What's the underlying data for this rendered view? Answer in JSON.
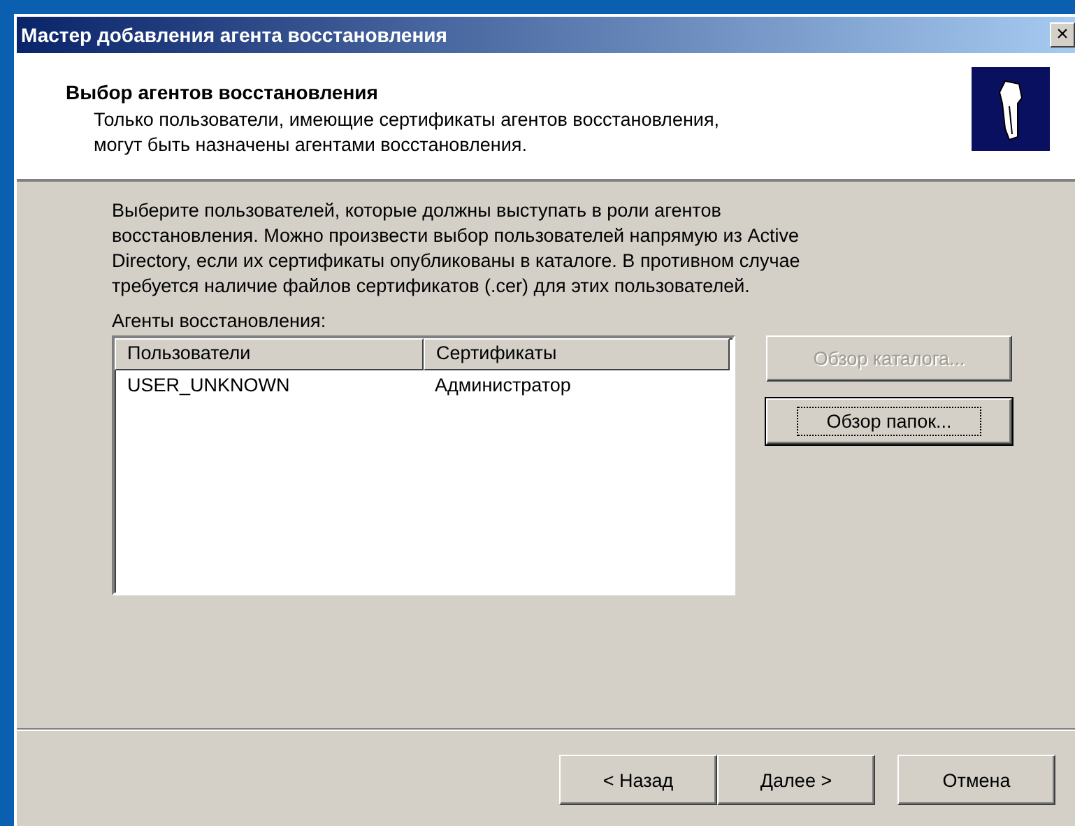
{
  "window": {
    "title": "Мастер добавления агента восстановления",
    "close": "×"
  },
  "header": {
    "title": "Выбор агентов восстановления",
    "subtitle": "Только пользователи, имеющие сертификаты агентов восстановления, могут быть назначены агентами восстановления."
  },
  "description": "Выберите пользователей, которые должны выступать в роли агентов восстановления. Можно произвести выбор пользователей напрямую из Active Directory, если их сертификаты опубликованы в каталоге. В противном случае требуется наличие файлов сертификатов (.cer) для этих пользователей.",
  "list_label": {
    "text": "Агенты восстановления:"
  },
  "table": {
    "columns": [
      "Пользователи",
      "Сертификаты"
    ],
    "rows": [
      {
        "cells": [
          "USER_UNKNOWN",
          "Администратор"
        ],
        "selected": false
      }
    ]
  },
  "side_buttons": [
    {
      "label": "Обзор каталога...",
      "disabled": true,
      "default": false
    },
    {
      "label": "Обзор папок...",
      "disabled": false,
      "default": true
    }
  ],
  "nav_buttons": [
    {
      "label": "< Назад",
      "disabled": false
    },
    {
      "label": "Далее >",
      "disabled": false
    },
    {
      "label": "Отмена",
      "disabled": false
    }
  ]
}
